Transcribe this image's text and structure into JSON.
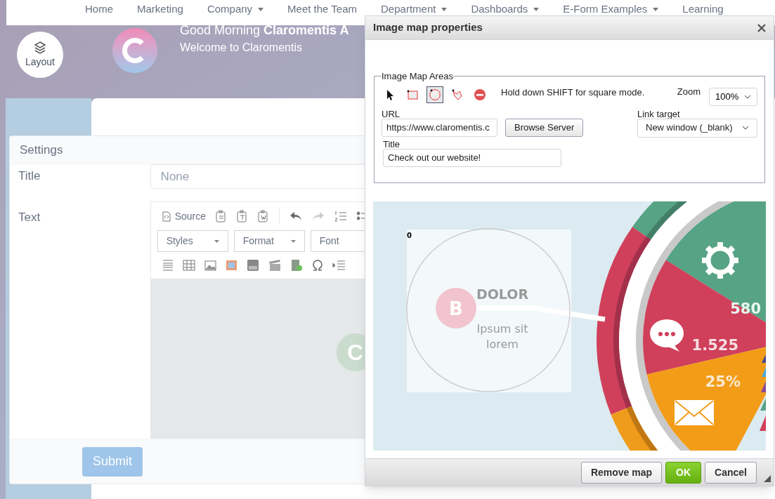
{
  "nav": {
    "items": [
      {
        "label": "Home",
        "has_menu": false
      },
      {
        "label": "Marketing",
        "has_menu": false
      },
      {
        "label": "Company",
        "has_menu": true
      },
      {
        "label": "Meet the Team",
        "has_menu": false
      },
      {
        "label": "Department",
        "has_menu": true
      },
      {
        "label": "Dashboards",
        "has_menu": true
      },
      {
        "label": "E-Form Examples",
        "has_menu": true
      },
      {
        "label": "Learning",
        "has_menu": false
      }
    ]
  },
  "header": {
    "layout_button": "Layout",
    "greeting": "Good Morning **Claromentis A**",
    "subtitle": "Welcome to Claromentis"
  },
  "settings": {
    "title": "Settings",
    "title_label": "Title",
    "title_placeholder": "None",
    "text_label": "Text",
    "source_button": "Source",
    "combos": [
      "Styles",
      "Format",
      "Font"
    ],
    "content_letter": "C",
    "submit": "Submit"
  },
  "dialog": {
    "title": "Image map properties",
    "legend": "Image Map Areas",
    "tools": [
      {
        "kind": "pointer",
        "selected": false
      },
      {
        "kind": "rectangle",
        "selected": false
      },
      {
        "kind": "circle",
        "selected": true
      },
      {
        "kind": "polygon",
        "selected": false
      },
      {
        "kind": "delete",
        "selected": false
      }
    ],
    "hint": "Hold down SHIFT for square mode.",
    "zoom_label": "Zoom",
    "zoom_value": "100%",
    "url_label": "URL",
    "url_value": "https://www.claromentis.c",
    "browse_button": "Browse Server",
    "target_label": "Link target",
    "target_value": "New window (_blank)",
    "title_label": "Title",
    "title_value": "Check out our website!",
    "area_index": "0",
    "image_texts": {
      "letter": "B",
      "heading": "DOLOR",
      "line_1": "Ipsum sit",
      "line_2": "lorem",
      "value_1": "580",
      "value_2": "1.525",
      "value_3": "25%"
    },
    "buttons": [
      "Remove map",
      "OK",
      "Cancel"
    ]
  }
}
